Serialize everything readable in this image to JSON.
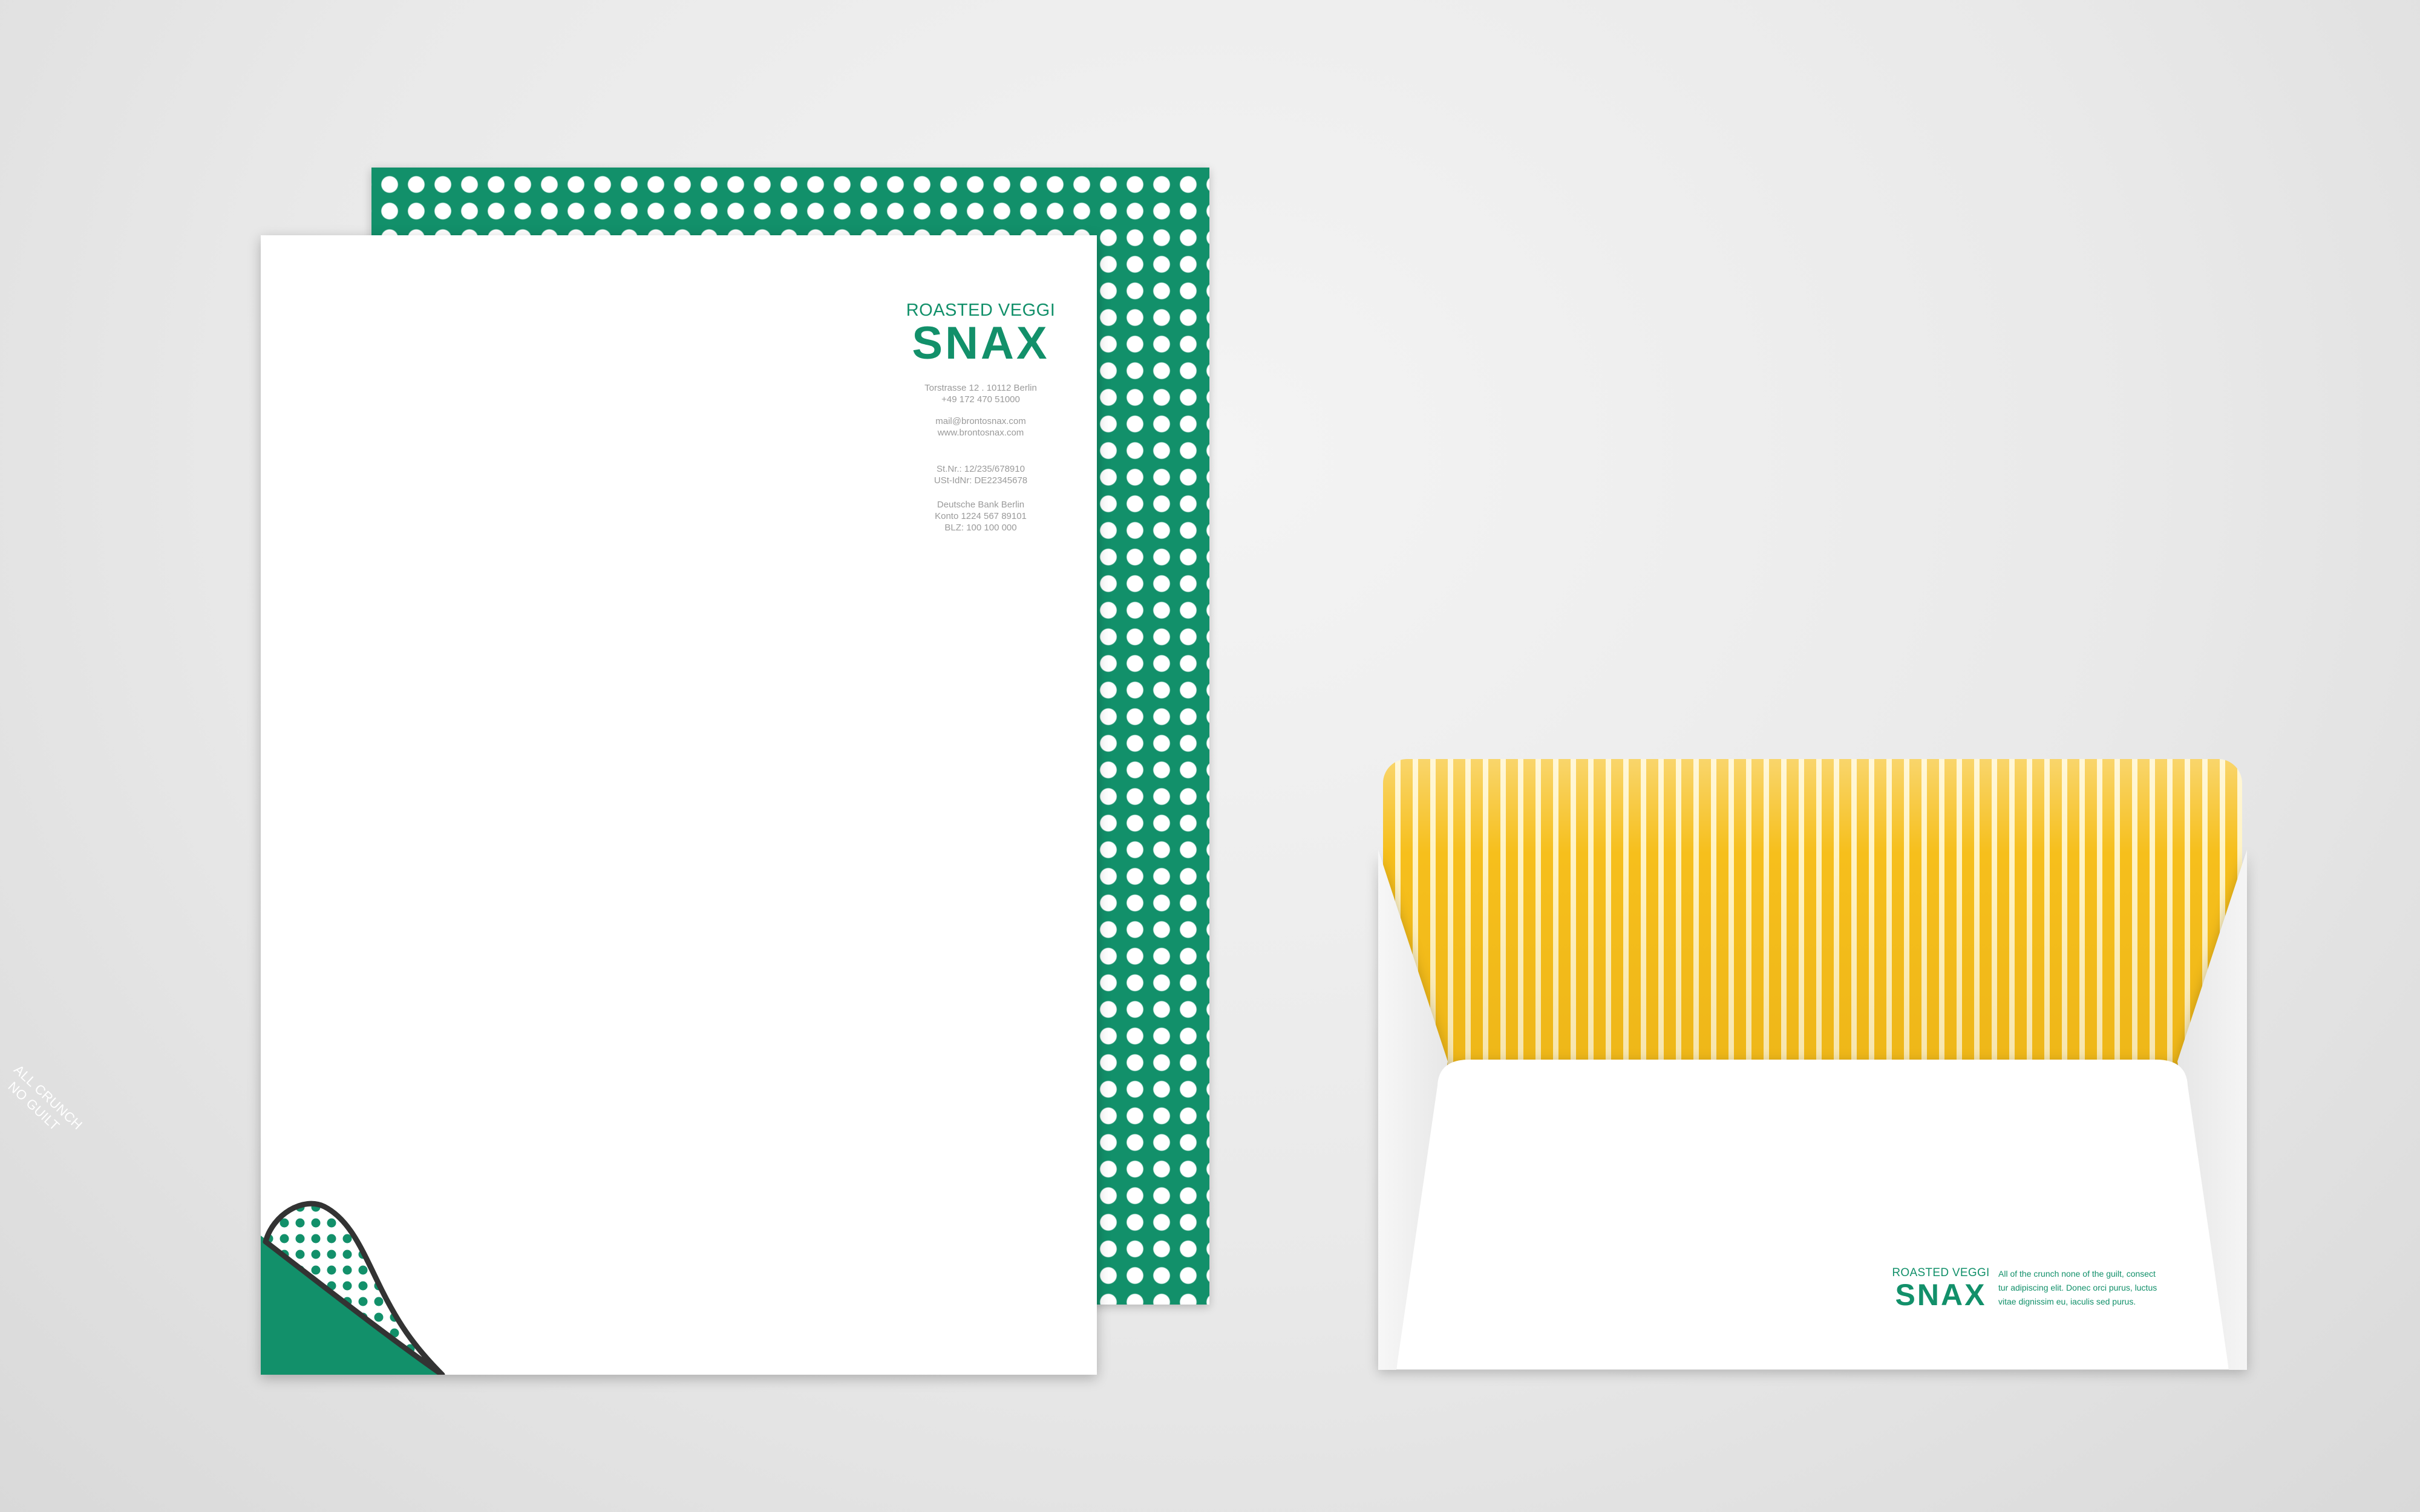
{
  "colors": {
    "brand_green": "#12906a",
    "stripe_yellow": "#f6bf1c",
    "background": "#e9e9e9"
  },
  "letterhead": {
    "brand_small": "ROASTED VEGGI",
    "brand_big": "SNAX",
    "address_line1": "Torstrasse 12 . 10112 Berlin",
    "address_line2": "+49 172 470 51000",
    "email": "mail@brontosnax.com",
    "website": "www.brontosnax.com",
    "tax_number": "St.Nr.: 12/235/678910",
    "vat_id": "USt-IdNr: DE22345678",
    "bank_name": "Deutsche Bank Berlin",
    "account": "Konto 1224 567 89101",
    "blz": "BLZ: 100 100 000",
    "corner_line1": "ALL CRUNCH",
    "corner_line2": "NO GUILT"
  },
  "envelope": {
    "brand_small": "ROASTED VEGGI",
    "brand_big": "SNAX",
    "tagline_line1": "All of the crunch none of the guilt, consect",
    "tagline_line2": "tur adipiscing elit. Donec orci purus, luctus",
    "tagline_line3": "vitae dignissim eu, iaculis sed purus."
  }
}
